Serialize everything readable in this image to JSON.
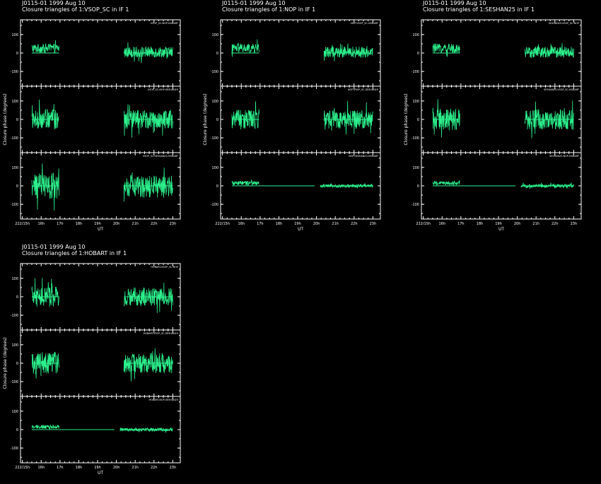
{
  "colors": {
    "background": "#000000",
    "axes": "#ffffff",
    "trace": "#2cf08c"
  },
  "chart_data": [
    {
      "type": "line",
      "source": "J0115-01",
      "date": "1999 Aug 10",
      "title_line1": "J0115-01   1999 Aug 10",
      "title_line2": "Closure triangles of 1:VSOP_SC in IF 1",
      "ylabel": "Closure phase   (degrees)",
      "xlabel": "UT",
      "ylim": [
        -180,
        180
      ],
      "yticks": [
        -100,
        0,
        100
      ],
      "xlim_hours": [
        14.9,
        23.4
      ],
      "xticks": [
        {
          "h": 15,
          "label": "222/15h"
        },
        {
          "h": 16,
          "label": "16h"
        },
        {
          "h": 17,
          "label": "17h"
        },
        {
          "h": 18,
          "label": "18h"
        },
        {
          "h": 19,
          "label": "19h"
        },
        {
          "h": 20,
          "label": "20h"
        },
        {
          "h": 21,
          "label": "21h"
        },
        {
          "h": 22,
          "label": "22h"
        },
        {
          "h": 23,
          "label": "23h"
        }
      ],
      "panels": [
        {
          "label": "VSOP_SC-NOP-HOBART",
          "segments": [
            {
              "start": 15.5,
              "end": 16.95,
              "scatter": 25,
              "mean": 25
            },
            {
              "start": 20.4,
              "end": 23.0,
              "scatter": 30,
              "mean": 5
            }
          ]
        },
        {
          "label": "VSOP_SC-NOP-SESHAN25",
          "segments": [
            {
              "start": 15.5,
              "end": 16.95,
              "scatter": 55,
              "mean": 0
            },
            {
              "start": 20.4,
              "end": 23.0,
              "scatter": 50,
              "mean": 0
            }
          ]
        },
        {
          "label": "VSOP_SC-SESHAN25-HOBART",
          "segments": [
            {
              "start": 15.5,
              "end": 16.95,
              "scatter": 70,
              "mean": 0
            },
            {
              "start": 20.4,
              "end": 23.0,
              "scatter": 60,
              "mean": -5
            }
          ]
        }
      ]
    },
    {
      "type": "line",
      "source": "J0115-01",
      "date": "1999 Aug 10",
      "title_line1": "J0115-01   1999 Aug 10",
      "title_line2": "Closure triangles of 1:NOP in IF 1",
      "ylabel": "Closure phase   (degrees)",
      "xlabel": "UT",
      "ylim": [
        -180,
        180
      ],
      "yticks": [
        -100,
        0,
        100
      ],
      "xlim_hours": [
        14.9,
        23.4
      ],
      "xticks": [
        {
          "h": 15,
          "label": "222/15h"
        },
        {
          "h": 16,
          "label": "16h"
        },
        {
          "h": 17,
          "label": "17h"
        },
        {
          "h": 18,
          "label": "18h"
        },
        {
          "h": 19,
          "label": "19h"
        },
        {
          "h": 20,
          "label": "20h"
        },
        {
          "h": 21,
          "label": "21h"
        },
        {
          "h": 22,
          "label": "22h"
        },
        {
          "h": 23,
          "label": "23h"
        }
      ],
      "panels": [
        {
          "label": "NOP-VSOP_SC-HOBART",
          "segments": [
            {
              "start": 15.5,
              "end": 16.95,
              "scatter": 25,
              "mean": 25
            },
            {
              "start": 20.4,
              "end": 23.0,
              "scatter": 30,
              "mean": 5
            }
          ]
        },
        {
          "label": "NOP-VSOP_SC-SESHAN25",
          "segments": [
            {
              "start": 15.5,
              "end": 16.95,
              "scatter": 55,
              "mean": 0
            },
            {
              "start": 20.4,
              "end": 23.0,
              "scatter": 50,
              "mean": 0
            }
          ]
        },
        {
          "label": "NOP-SESHAN25-HOBART",
          "segments": [
            {
              "start": 15.5,
              "end": 16.95,
              "scatter": 10,
              "mean": 15
            },
            {
              "start": 20.2,
              "end": 23.0,
              "scatter": 9,
              "mean": 0
            }
          ],
          "refline": [
            15.5,
            19.9
          ]
        }
      ]
    },
    {
      "type": "line",
      "source": "J0115-01",
      "date": "1999 Aug 10",
      "title_line1": "J0115-01   1999 Aug 10",
      "title_line2": "Closure triangles of 1:SESHAN25 in IF 1",
      "ylabel": "Closure phase   (degrees)",
      "xlabel": "UT",
      "ylim": [
        -180,
        180
      ],
      "yticks": [
        -100,
        0,
        100
      ],
      "xlim_hours": [
        14.9,
        23.4
      ],
      "xticks": [
        {
          "h": 15,
          "label": "222/15h"
        },
        {
          "h": 16,
          "label": "16h"
        },
        {
          "h": 17,
          "label": "17h"
        },
        {
          "h": 18,
          "label": "18h"
        },
        {
          "h": 19,
          "label": "19h"
        },
        {
          "h": 20,
          "label": "20h"
        },
        {
          "h": 21,
          "label": "21h"
        },
        {
          "h": 22,
          "label": "22h"
        },
        {
          "h": 23,
          "label": "23h"
        }
      ],
      "panels": [
        {
          "label": "SESHAN25-VSOP_SC-NOP",
          "segments": [
            {
              "start": 15.5,
              "end": 16.95,
              "scatter": 25,
              "mean": 25
            },
            {
              "start": 20.4,
              "end": 23.0,
              "scatter": 30,
              "mean": 5
            }
          ]
        },
        {
          "label": "SESHAN25-VSOP_SC-HOBART",
          "segments": [
            {
              "start": 15.5,
              "end": 16.95,
              "scatter": 60,
              "mean": 0
            },
            {
              "start": 20.4,
              "end": 23.0,
              "scatter": 55,
              "mean": 0
            }
          ]
        },
        {
          "label": "SESHAN25-NOP-HOBART",
          "segments": [
            {
              "start": 15.5,
              "end": 16.95,
              "scatter": 10,
              "mean": 15
            },
            {
              "start": 20.2,
              "end": 23.0,
              "scatter": 9,
              "mean": 0
            }
          ],
          "refline": [
            15.5,
            19.9
          ]
        }
      ]
    },
    {
      "type": "line",
      "source": "J0115-01",
      "date": "1999 Aug 10",
      "title_line1": "J0115-01   1999 Aug 10",
      "title_line2": "Closure triangles of 1:HOBART in IF 1",
      "ylabel": "Closure phase   (degrees)",
      "xlabel": "UT",
      "ylim": [
        -180,
        180
      ],
      "yticks": [
        -100,
        0,
        100
      ],
      "xlim_hours": [
        14.9,
        23.4
      ],
      "xticks": [
        {
          "h": 15,
          "label": "222/15h"
        },
        {
          "h": 16,
          "label": "16h"
        },
        {
          "h": 17,
          "label": "17h"
        },
        {
          "h": 18,
          "label": "18h"
        },
        {
          "h": 19,
          "label": "19h"
        },
        {
          "h": 20,
          "label": "20h"
        },
        {
          "h": 21,
          "label": "21h"
        },
        {
          "h": 22,
          "label": "22h"
        },
        {
          "h": 23,
          "label": "23h"
        }
      ],
      "panels": [
        {
          "label": "HOBART-VSOP_SC-NOP",
          "segments": [
            {
              "start": 15.5,
              "end": 16.95,
              "scatter": 55,
              "mean": 0
            },
            {
              "start": 20.4,
              "end": 23.0,
              "scatter": 50,
              "mean": 0
            }
          ]
        },
        {
          "label": "HOBART-VSOP_SC-SESHAN25",
          "segments": [
            {
              "start": 15.5,
              "end": 16.95,
              "scatter": 60,
              "mean": 0
            },
            {
              "start": 20.4,
              "end": 23.0,
              "scatter": 55,
              "mean": 0
            }
          ]
        },
        {
          "label": "HOBART-NOP-SESHAN25",
          "segments": [
            {
              "start": 15.5,
              "end": 16.95,
              "scatter": 10,
              "mean": 15
            },
            {
              "start": 20.2,
              "end": 23.0,
              "scatter": 9,
              "mean": 0
            }
          ],
          "refline": [
            15.5,
            19.9
          ]
        }
      ]
    }
  ]
}
